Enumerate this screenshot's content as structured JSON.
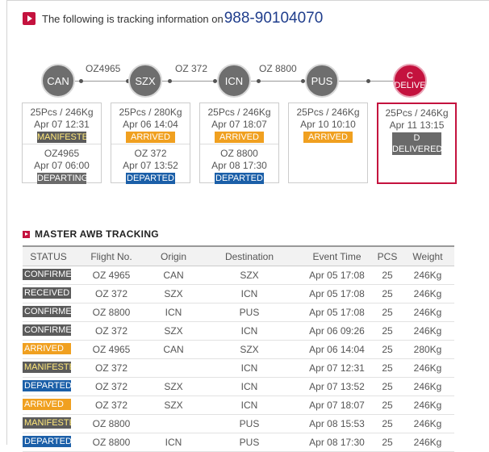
{
  "header": {
    "text": "The following is tracking information on",
    "awb": "988-90104070"
  },
  "route": {
    "nodes": [
      {
        "code": "CAN"
      },
      {
        "code": "SZX"
      },
      {
        "code": "ICN"
      },
      {
        "code": "PUS"
      },
      {
        "code": "C",
        "code2": "DELIVE"
      }
    ],
    "flights": [
      "OZ4965",
      "OZ 372",
      "OZ 8800"
    ],
    "cards": [
      {
        "pcs": "25Pcs / 246Kg",
        "date": "Apr 07 12:31",
        "status": "MANIFESTED",
        "pcs2": "OZ4965",
        "date2": "Apr 07 06:00",
        "status2": "DEPARTING"
      },
      {
        "pcs": "25Pcs / 280Kg",
        "date": "Apr 06 14:04",
        "status": "ARRIVED",
        "pcs2": "OZ 372",
        "date2": "Apr 07 13:52",
        "status2": "DEPARTED"
      },
      {
        "pcs": "25Pcs / 246Kg",
        "date": "Apr 07 18:07",
        "status": "ARRIVED",
        "pcs2": "OZ 8800",
        "date2": "Apr 08 17:30",
        "status2": "DEPARTED"
      },
      {
        "pcs": "25Pcs / 246Kg",
        "date": "Apr 10 10:10",
        "status": "ARRIVED"
      },
      {
        "pcs": "25Pcs / 246Kg",
        "date": "Apr 11 13:15",
        "status": "D",
        "status_b": "DELIVERED"
      }
    ]
  },
  "master": {
    "title": "MASTER AWB TRACKING",
    "columns": [
      "STATUS",
      "Flight No.",
      "Origin",
      "Destination",
      "Event Time",
      "PCS",
      "Weight"
    ],
    "rows": [
      {
        "status": "CONFIRMED",
        "flight": "OZ 4965",
        "origin": "CAN",
        "dest": "SZX",
        "time": "Apr 05 17:08",
        "pcs": "25",
        "weight": "246Kg"
      },
      {
        "status": "RECEIVED",
        "flight": "OZ 372",
        "origin": "SZX",
        "dest": "ICN",
        "time": "Apr 05 17:08",
        "pcs": "25",
        "weight": "246Kg"
      },
      {
        "status": "CONFIRMED",
        "flight": "OZ 8800",
        "origin": "ICN",
        "dest": "PUS",
        "time": "Apr 05 17:08",
        "pcs": "25",
        "weight": "246Kg"
      },
      {
        "status": "CONFIRMED",
        "flight": "OZ 372",
        "origin": "SZX",
        "dest": "ICN",
        "time": "Apr 06 09:26",
        "pcs": "25",
        "weight": "246Kg"
      },
      {
        "status": "ARRIVED",
        "flight": "OZ 4965",
        "origin": "CAN",
        "dest": "SZX",
        "time": "Apr 06 14:04",
        "pcs": "25",
        "weight": "280Kg"
      },
      {
        "status": "MANIFESTED",
        "flight": "OZ 372",
        "origin": "",
        "dest": "ICN",
        "time": "Apr 07 12:31",
        "pcs": "25",
        "weight": "246Kg"
      },
      {
        "status": "DEPARTED",
        "flight": "OZ 372",
        "origin": "SZX",
        "dest": "ICN",
        "time": "Apr 07 13:52",
        "pcs": "25",
        "weight": "246Kg"
      },
      {
        "status": "ARRIVED",
        "flight": "OZ 372",
        "origin": "SZX",
        "dest": "ICN",
        "time": "Apr 07 18:07",
        "pcs": "25",
        "weight": "246Kg"
      },
      {
        "status": "MANIFESTED",
        "flight": "OZ 8800",
        "origin": "",
        "dest": "PUS",
        "time": "Apr 08 15:53",
        "pcs": "25",
        "weight": "246Kg"
      },
      {
        "status": "DEPARTED",
        "flight": "OZ 8800",
        "origin": "ICN",
        "dest": "PUS",
        "time": "Apr 08 17:30",
        "pcs": "25",
        "weight": "246Kg"
      }
    ]
  },
  "colors": {
    "accent": "#c4123e",
    "arrived": "#f0a020",
    "departed": "#1b5fa8",
    "gray": "#5b5b5b",
    "link": "#1f3d8c"
  }
}
